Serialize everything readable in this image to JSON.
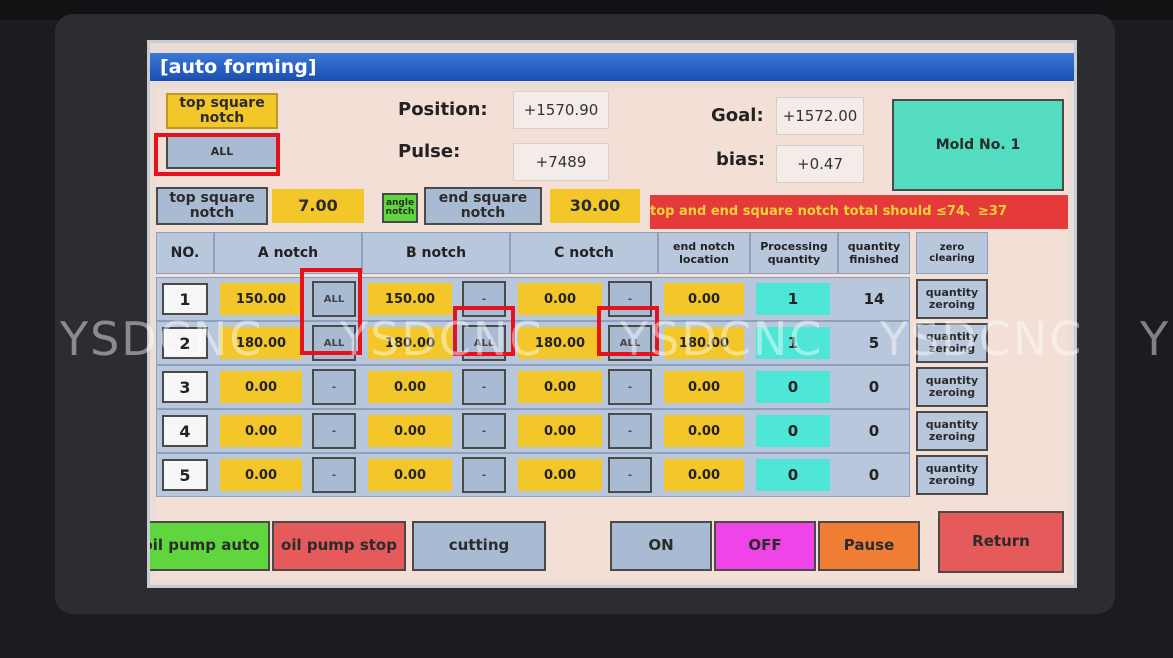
{
  "title": "[auto forming]",
  "top_square_notch": {
    "label": "top square notch",
    "all_label": "ALL"
  },
  "position": {
    "label": "Position:",
    "value": "+1570.90"
  },
  "pulse": {
    "label": "Pulse:",
    "value": "+7489"
  },
  "goal": {
    "label": "Goal:",
    "value": "+1572.00"
  },
  "bias": {
    "label": "bias:",
    "value": "+0.47"
  },
  "mold": {
    "label": "Mold No. 1"
  },
  "settings_row": {
    "top_notch_label": "top square notch",
    "top_notch_value": "7.00",
    "angle_notch_label": "angle notch",
    "end_notch_label": "end square notch",
    "end_notch_value": "30.00",
    "warning": "top and end square notch total should ≤74、≥37"
  },
  "table": {
    "headers": {
      "no": "NO.",
      "a": "A notch",
      "b": "B notch",
      "c": "C notch",
      "end": "end notch location",
      "proc": "Processing quantity",
      "fin": "quantity finished",
      "zero": "zero clearing"
    },
    "rows": [
      {
        "no": "1",
        "a": "150.00",
        "a_btn": "ALL",
        "b": "150.00",
        "b_btn": "-",
        "c": "0.00",
        "c_btn": "-",
        "end": "0.00",
        "proc": "1",
        "fin": "14",
        "zero": "quantity zeroing"
      },
      {
        "no": "2",
        "a": "180.00",
        "a_btn": "ALL",
        "b": "180.00",
        "b_btn": "ALL",
        "c": "180.00",
        "c_btn": "ALL",
        "end": "180.00",
        "proc": "1",
        "fin": "5",
        "zero": "quantity zeroing"
      },
      {
        "no": "3",
        "a": "0.00",
        "a_btn": "-",
        "b": "0.00",
        "b_btn": "-",
        "c": "0.00",
        "c_btn": "-",
        "end": "0.00",
        "proc": "0",
        "fin": "0",
        "zero": "quantity zeroing"
      },
      {
        "no": "4",
        "a": "0.00",
        "a_btn": "-",
        "b": "0.00",
        "b_btn": "-",
        "c": "0.00",
        "c_btn": "-",
        "end": "0.00",
        "proc": "0",
        "fin": "0",
        "zero": "quantity zeroing"
      },
      {
        "no": "5",
        "a": "0.00",
        "a_btn": "-",
        "b": "0.00",
        "b_btn": "-",
        "c": "0.00",
        "c_btn": "-",
        "end": "0.00",
        "proc": "0",
        "fin": "0",
        "zero": "quantity zeroing"
      }
    ]
  },
  "bottom": {
    "oil_auto": "oil pump auto",
    "oil_stop": "oil pump stop",
    "cutting": "cutting",
    "on": "ON",
    "off": "OFF",
    "pause": "Pause",
    "return": "Return"
  },
  "watermark": [
    "YSDCNC",
    "YSDCNC",
    "YSDCNC",
    "YSDCNC",
    "Y"
  ],
  "colors": {
    "yellow": "#f3c72a",
    "cyan": "#4ee6d6",
    "green": "#5fd63d",
    "red": "#e55a5a",
    "magenta": "#ef44e7",
    "orange": "#ef7e34",
    "mold_teal": "#54dcc0",
    "title_blue": "#1a4fb0",
    "highlight_red": "#e3121b"
  }
}
